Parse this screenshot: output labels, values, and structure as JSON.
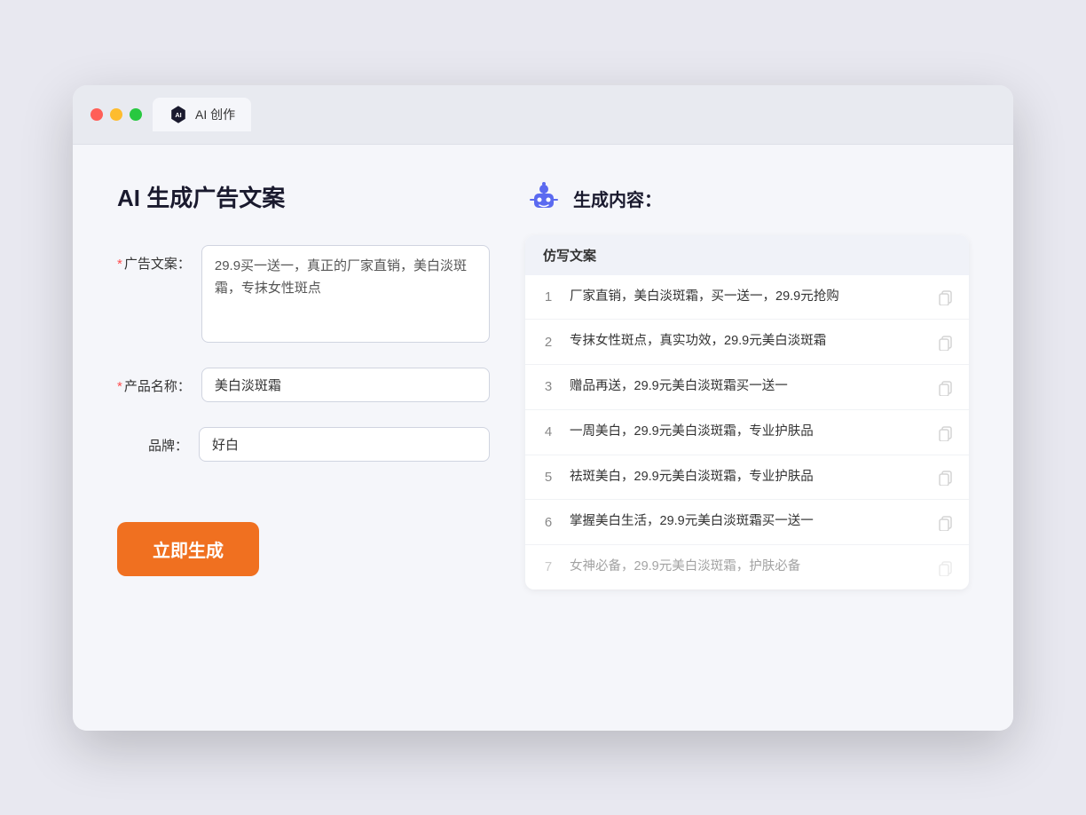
{
  "browser": {
    "tab_label": "AI 创作"
  },
  "page": {
    "title": "AI 生成广告文案",
    "right_title": "生成内容："
  },
  "form": {
    "ad_copy_label": "广告文案：",
    "ad_copy_required": "*",
    "ad_copy_value": "29.9买一送一，真正的厂家直销，美白淡斑霜，专抹女性斑点",
    "product_name_label": "产品名称：",
    "product_name_required": "*",
    "product_name_value": "美白淡斑霜",
    "brand_label": "品牌：",
    "brand_value": "好白",
    "generate_button": "立即生成"
  },
  "results": {
    "column_header": "仿写文案",
    "items": [
      {
        "num": "1",
        "text": "厂家直销，美白淡斑霜，买一送一，29.9元抢购",
        "faded": false
      },
      {
        "num": "2",
        "text": "专抹女性斑点，真实功效，29.9元美白淡斑霜",
        "faded": false
      },
      {
        "num": "3",
        "text": "赠品再送，29.9元美白淡斑霜买一送一",
        "faded": false
      },
      {
        "num": "4",
        "text": "一周美白，29.9元美白淡斑霜，专业护肤品",
        "faded": false
      },
      {
        "num": "5",
        "text": "祛斑美白，29.9元美白淡斑霜，专业护肤品",
        "faded": false
      },
      {
        "num": "6",
        "text": "掌握美白生活，29.9元美白淡斑霜买一送一",
        "faded": false
      },
      {
        "num": "7",
        "text": "女神必备，29.9元美白淡斑霜，护肤必备",
        "faded": true
      }
    ]
  }
}
